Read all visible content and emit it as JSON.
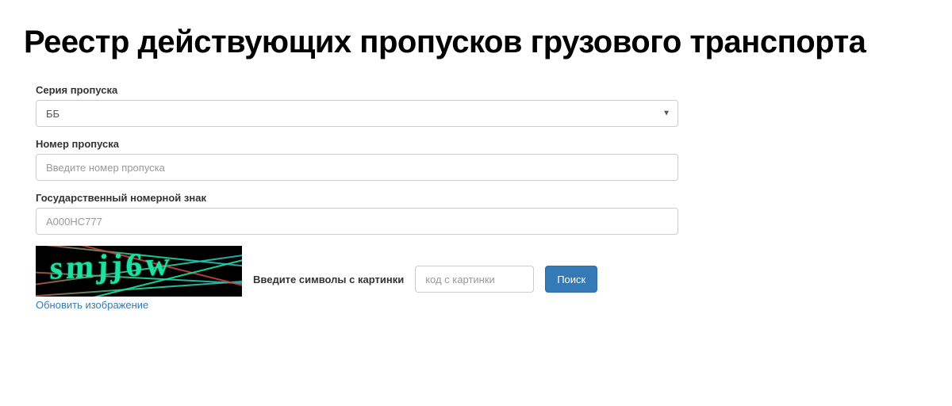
{
  "title": "Реестр действующих пропусков грузового транспорта",
  "form": {
    "series": {
      "label": "Серия пропуска",
      "selected": "ББ"
    },
    "number": {
      "label": "Номер пропуска",
      "placeholder": "Введите номер пропуска"
    },
    "plate": {
      "label": "Государственный номерной знак",
      "placeholder": "А000НС777"
    },
    "captcha": {
      "image_text": "smjj6w",
      "refresh": "Обновить изображение",
      "label": "Введите символы с картинки",
      "placeholder": "код с картинки"
    },
    "search_button": "Поиск"
  }
}
